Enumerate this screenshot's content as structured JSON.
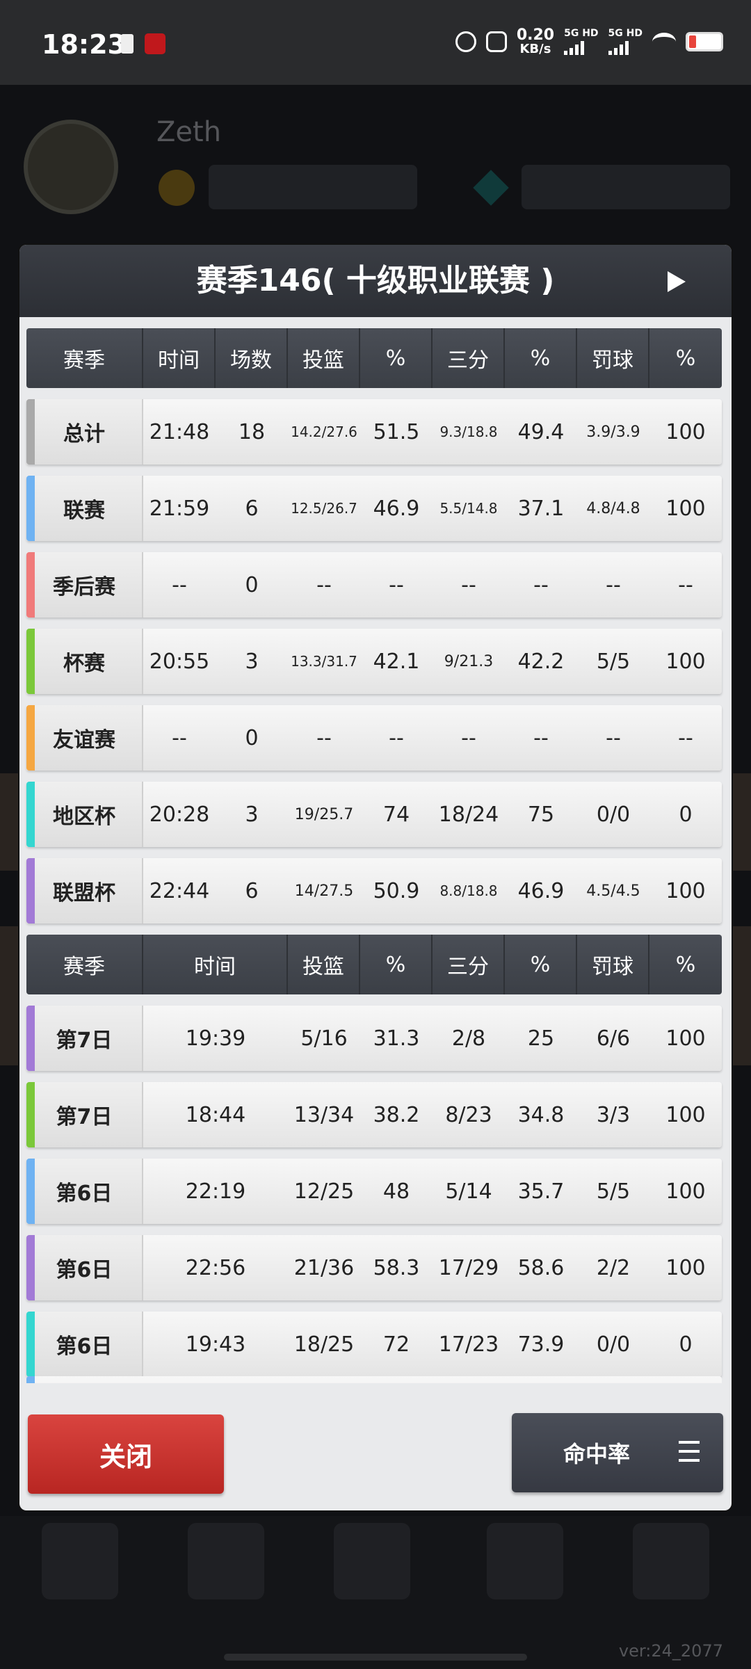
{
  "status_bar": {
    "time": "18:23",
    "net_speed_value": "0.20",
    "net_speed_unit": "KB/s",
    "sim1": "5G HD",
    "sim2": "5G HD",
    "icons": [
      "sim-card-icon",
      "app-notification-icon",
      "alarm-icon",
      "mute-icon",
      "signal-icon",
      "wifi-icon",
      "battery-low-icon"
    ]
  },
  "background": {
    "player_name": "Zeth",
    "version": "ver:24_2077"
  },
  "modal": {
    "title": "赛季146( 十级职业联赛 )",
    "summary_table": {
      "headers": [
        "赛季",
        "时间",
        "场数",
        "投篮",
        "%",
        "三分",
        "%",
        "罚球",
        "%"
      ],
      "rows": [
        {
          "label": "总计",
          "color": "#a9a9a9",
          "cells": [
            "21:48",
            "18",
            "14.2/27.6",
            "51.5",
            "9.3/18.8",
            "49.4",
            "3.9/3.9",
            "100"
          ]
        },
        {
          "label": "联赛",
          "color": "#6fb2f2",
          "cells": [
            "21:59",
            "6",
            "12.5/26.7",
            "46.9",
            "5.5/14.8",
            "37.1",
            "4.8/4.8",
            "100"
          ]
        },
        {
          "label": "季后赛",
          "color": "#f07a7a",
          "cells": [
            "--",
            "0",
            "--",
            "--",
            "--",
            "--",
            "--",
            "--"
          ]
        },
        {
          "label": "杯赛",
          "color": "#7bc83a",
          "cells": [
            "20:55",
            "3",
            "13.3/31.7",
            "42.1",
            "9/21.3",
            "42.2",
            "5/5",
            "100"
          ]
        },
        {
          "label": "友谊赛",
          "color": "#f5a742",
          "cells": [
            "--",
            "0",
            "--",
            "--",
            "--",
            "--",
            "--",
            "--"
          ]
        },
        {
          "label": "地区杯",
          "color": "#34d6d0",
          "cells": [
            "20:28",
            "3",
            "19/25.7",
            "74",
            "18/24",
            "75",
            "0/0",
            "0"
          ]
        },
        {
          "label": "联盟杯",
          "color": "#a27ad6",
          "cells": [
            "22:44",
            "6",
            "14/27.5",
            "50.9",
            "8.8/18.8",
            "46.9",
            "4.5/4.5",
            "100"
          ]
        }
      ]
    },
    "games_table": {
      "headers": [
        "赛季",
        "时间",
        "投篮",
        "%",
        "三分",
        "%",
        "罚球",
        "%"
      ],
      "rows": [
        {
          "label": "第7日",
          "color": "#a27ad6",
          "cells": [
            "19:39",
            "5/16",
            "31.3",
            "2/8",
            "25",
            "6/6",
            "100"
          ]
        },
        {
          "label": "第7日",
          "color": "#7bc83a",
          "cells": [
            "18:44",
            "13/34",
            "38.2",
            "8/23",
            "34.8",
            "3/3",
            "100"
          ]
        },
        {
          "label": "第6日",
          "color": "#6fb2f2",
          "cells": [
            "22:19",
            "12/25",
            "48",
            "5/14",
            "35.7",
            "5/5",
            "100"
          ]
        },
        {
          "label": "第6日",
          "color": "#a27ad6",
          "cells": [
            "22:56",
            "21/36",
            "58.3",
            "17/29",
            "58.6",
            "2/2",
            "100"
          ]
        },
        {
          "label": "第6日",
          "color": "#34d6d0",
          "cells": [
            "19:43",
            "18/25",
            "72",
            "17/23",
            "73.9",
            "0/0",
            "0"
          ]
        }
      ],
      "partial_row_color": "#6fb2f2"
    },
    "close_button": "关闭",
    "rate_button": "命中率"
  }
}
